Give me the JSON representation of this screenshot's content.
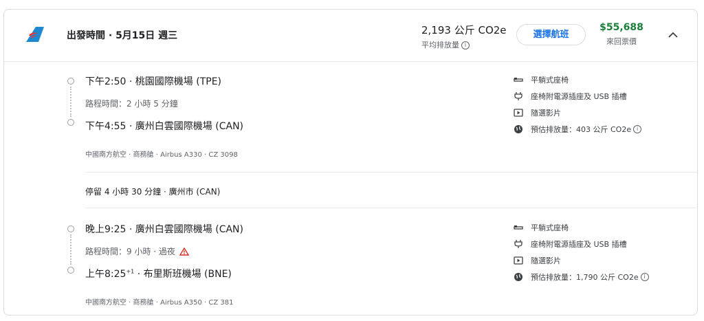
{
  "header": {
    "airline_logo": "china-southern-logo",
    "title": "出發時間 · 5月15日 週三",
    "emissions_value": "2,193 公斤 CO2e",
    "emissions_label": "平均排放量",
    "select_button": "選擇航班",
    "price": "$55,688",
    "price_label": "來回票價",
    "collapse_icon": "chevron-up-icon"
  },
  "segments": [
    {
      "depart": "下午2:50 · 桃園國際機場 (TPE)",
      "duration": "路程時間：2 小時 5 分鐘",
      "arrive_time": "下午4:55",
      "arrive_sup": "",
      "arrive_airport": " · 廣州白雲國際機場 (CAN)",
      "meta": "中國南方航空 · 商務艙 · Airbus A330 · CZ 3098",
      "amenities": [
        {
          "icon": "seat-icon",
          "label": "平躺式座椅"
        },
        {
          "icon": "power-plug-icon",
          "label": "座椅附電源插座及 USB 插槽"
        },
        {
          "icon": "video-icon",
          "label": "隨選影片"
        },
        {
          "icon": "globe-icon",
          "label": "預估排放量：403 公斤 CO2e"
        }
      ]
    },
    {
      "depart": "晚上9:25 · 廣州白雲國際機場 (CAN)",
      "duration": "路程時間：9 小時 · 過夜",
      "arrive_time": "上午8:25",
      "arrive_sup": "+1",
      "arrive_airport": " · 布里斯班機場 (BNE)",
      "meta": "中國南方航空 · 商務艙 · Airbus A350 · CZ 381",
      "amenities": [
        {
          "icon": "seat-icon",
          "label": "平躺式座椅"
        },
        {
          "icon": "power-plug-icon",
          "label": "座椅附電源插座及 USB 插槽"
        },
        {
          "icon": "video-icon",
          "label": "隨選影片"
        },
        {
          "icon": "globe-icon",
          "label": "預估排放量：1,790 公斤 CO2e"
        }
      ]
    }
  ],
  "layover": "停留 4 小時 30 分鐘 · 廣州市 (CAN)",
  "colors": {
    "accent": "#1a73e8",
    "price": "#188038",
    "logo_blue": "#1e88d0",
    "logo_red": "#e53935",
    "warning": "#d93025"
  }
}
